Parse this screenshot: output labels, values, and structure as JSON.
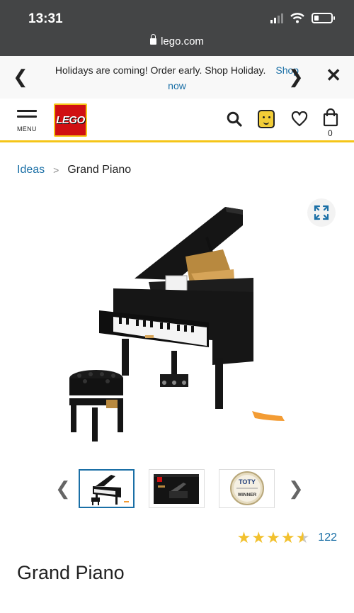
{
  "status_bar": {
    "time": "13:31"
  },
  "browser": {
    "url": "lego.com"
  },
  "promo": {
    "text": "Holidays are coming! Order early. Shop Holiday.",
    "link": "Shop now"
  },
  "header": {
    "menu_label": "MENU",
    "logo_text": "LEGO",
    "bag_count": "0"
  },
  "breadcrumb": {
    "parent": "Ideas",
    "current": "Grand Piano"
  },
  "thumbs": {
    "badge_title": "TOTY",
    "badge_label": "WINNER"
  },
  "rating": {
    "stars": 4.5,
    "count": "122"
  },
  "product": {
    "title": "Grand Piano"
  },
  "colors": {
    "accent": "#1a6fa6",
    "brand_red": "#d01012",
    "brand_yellow": "#f5c518",
    "star": "#f2c12e"
  }
}
